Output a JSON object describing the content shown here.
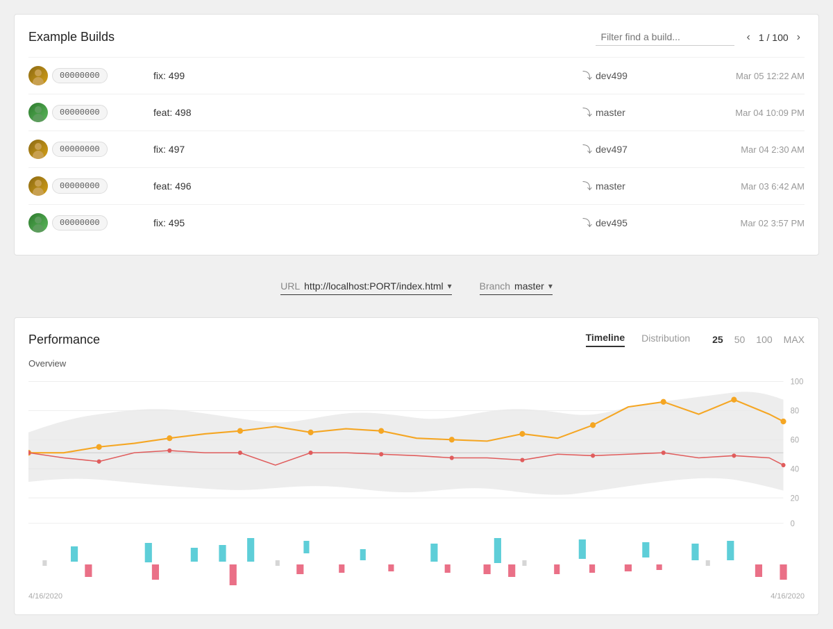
{
  "page": {
    "title": "Example Builds"
  },
  "filter": {
    "placeholder": "Filter find a build..."
  },
  "pagination": {
    "current": 1,
    "total": 100,
    "display": "1 / 100"
  },
  "builds": [
    {
      "id": "build-1",
      "hash": "00000000",
      "message": "fix: 499",
      "branch": "dev499",
      "date": "Mar 05 12:22 AM",
      "avatar_type": "1"
    },
    {
      "id": "build-2",
      "hash": "00000000",
      "message": "feat: 498",
      "branch": "master",
      "date": "Mar 04 10:09 PM",
      "avatar_type": "2"
    },
    {
      "id": "build-3",
      "hash": "00000000",
      "message": "fix: 497",
      "branch": "dev497",
      "date": "Mar 04 2:30 AM",
      "avatar_type": "1"
    },
    {
      "id": "build-4",
      "hash": "00000000",
      "message": "feat: 496",
      "branch": "master",
      "date": "Mar 03 6:42 AM",
      "avatar_type": "1"
    },
    {
      "id": "build-5",
      "hash": "00000000",
      "message": "fix: 495",
      "branch": "dev495",
      "date": "Mar 02 3:57 PM",
      "avatar_type": "2"
    }
  ],
  "url_selector": {
    "label": "URL",
    "value": "http://localhost:PORT/index.html"
  },
  "branch_selector": {
    "label": "Branch",
    "value": "master"
  },
  "performance": {
    "title": "Performance",
    "tabs": [
      "Timeline",
      "Distribution"
    ],
    "active_tab": "Timeline",
    "numbers": [
      "25",
      "50",
      "100",
      "MAX"
    ],
    "active_number": "25",
    "overview_label": "Overview",
    "y_labels": [
      "100",
      "80",
      "60",
      "40",
      "20",
      "0"
    ],
    "date_start": "4/16/2020",
    "date_end": "4/16/2020"
  }
}
